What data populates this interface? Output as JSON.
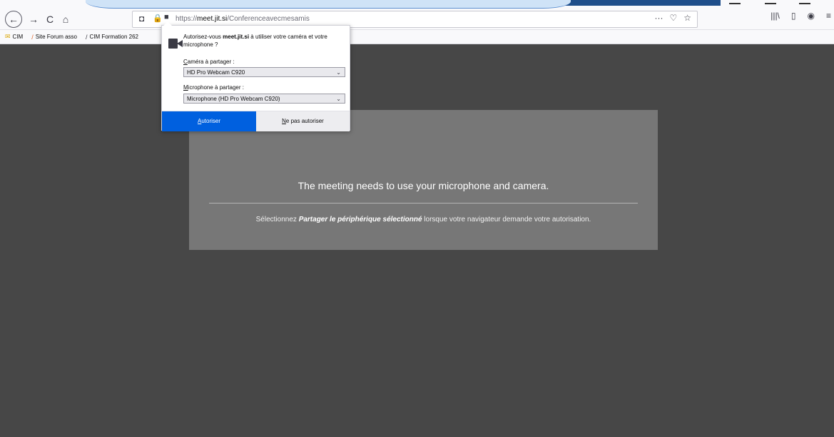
{
  "browser": {
    "url_prefix": "https://",
    "url_domain": "meet.jit.si",
    "url_path": "/Conferenceavecmesamis",
    "icons": {
      "back": "←",
      "forward": "→",
      "reload": "C",
      "home": "⌂",
      "shield": "◘",
      "lock": "🔒",
      "camera": "■",
      "more": "···",
      "pocket": "♡",
      "star": "☆",
      "library": "|||\\",
      "sidebar": "▯",
      "account": "◉",
      "menu": "≡"
    }
  },
  "bookmarks": [
    {
      "label": "CIM",
      "icon": "✉"
    },
    {
      "label": "Site Forum asso",
      "icon": "/"
    },
    {
      "label": "CIM Formation 262",
      "icon": "/"
    }
  ],
  "permission_popup": {
    "question_pre": "Autorisez-vous ",
    "question_domain": "meet.jit.si",
    "question_post": " à utiliser votre caméra et votre microphone ?",
    "camera_label_key": "C",
    "camera_label_rest": "améra à partager :",
    "camera_value": "HD Pro Webcam C920",
    "mic_label_key": "M",
    "mic_label_rest": "icrophone à partager :",
    "mic_value": "Microphone (HD Pro Webcam C920)",
    "chevron": "⌄",
    "allow_key": "A",
    "allow_rest": "utoriser",
    "deny_key": "N",
    "deny_rest": "e pas autoriser"
  },
  "meeting": {
    "title": "The meeting needs to use your microphone and camera.",
    "hint_pre": "Sélectionnez ",
    "hint_bold": "Partager le périphérique sélectionné",
    "hint_post": " lorsque votre navigateur demande votre autorisation."
  },
  "colors": {
    "accent": "#0060df",
    "page_bg": "#474747",
    "panel_bg": "#777777"
  }
}
